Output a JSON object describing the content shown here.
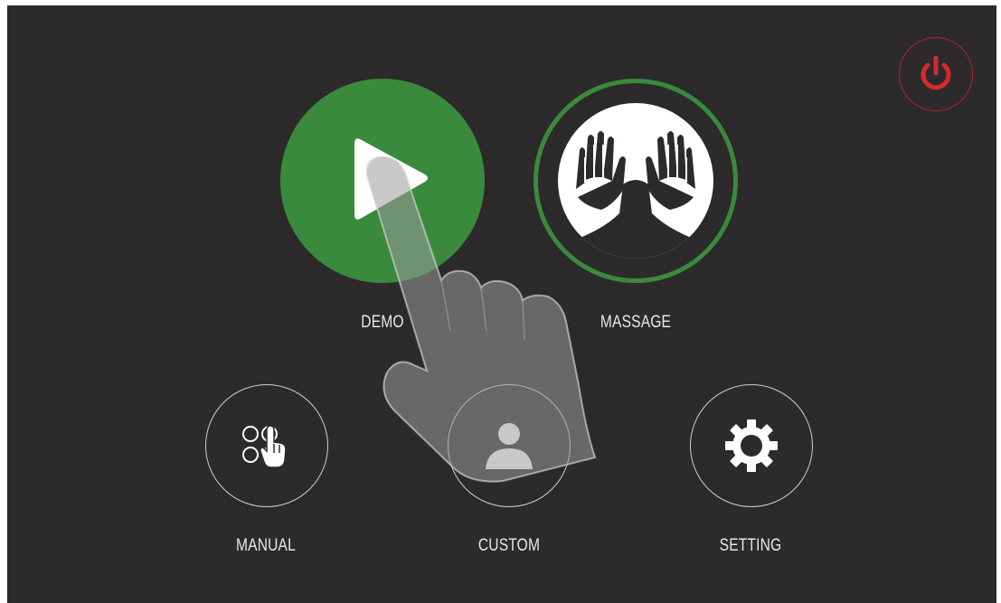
{
  "menu": {
    "demo_label": "DEMO",
    "massage_label": "MASSAGE",
    "manual_label": "MANUAL",
    "custom_label": "CUSTOM",
    "setting_label": "SETTING"
  },
  "icons": {
    "power": "power-icon",
    "demo": "play-icon",
    "massage": "hands-massage-icon",
    "manual": "manual-select-icon",
    "custom": "user-icon",
    "setting": "gear-icon",
    "overlay": "pointing-hand-icon"
  },
  "colors": {
    "background": "#2d2a2b",
    "accent_green": "#3a8a3d",
    "power_red": "#d42a2f",
    "text": "#e8e8e8"
  }
}
